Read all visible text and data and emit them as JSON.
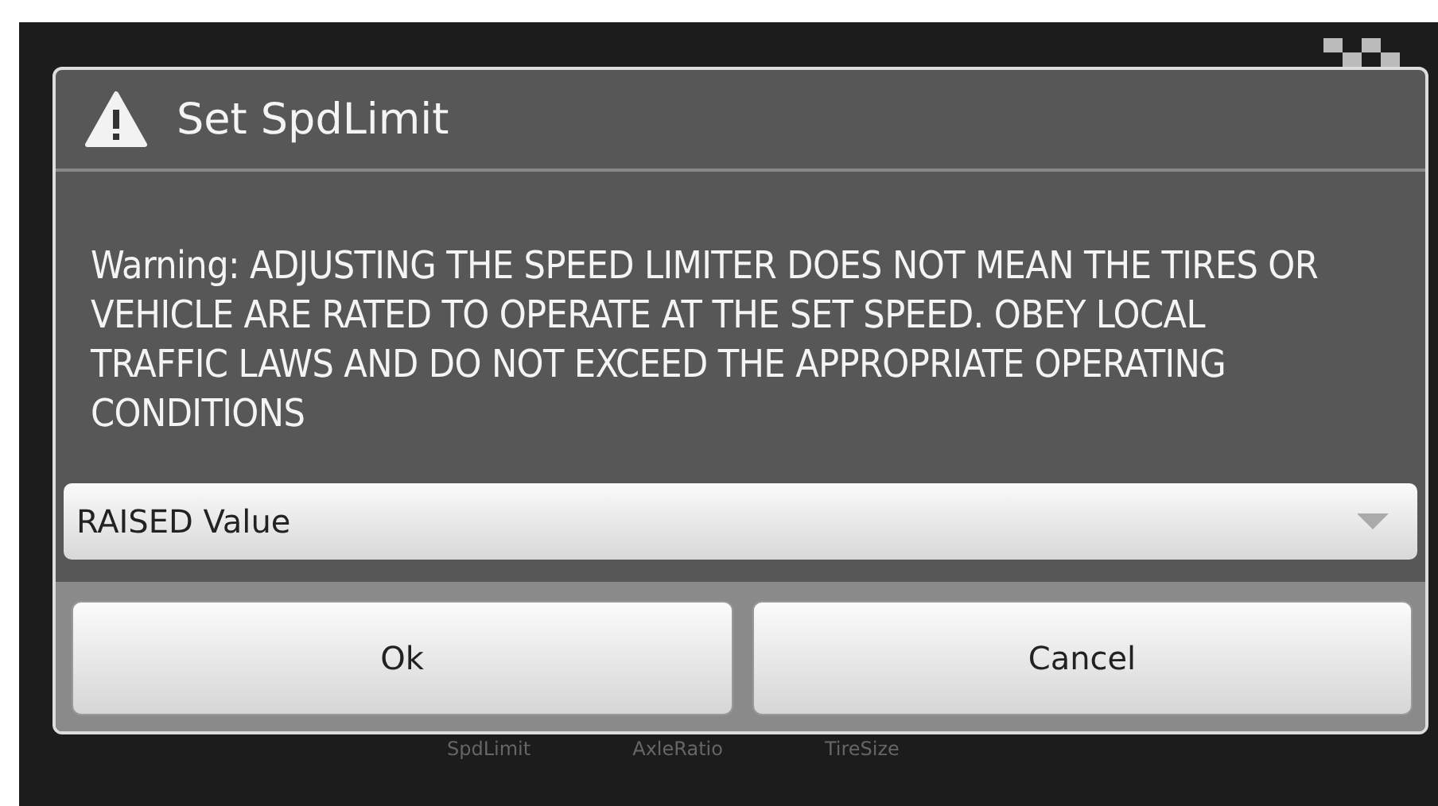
{
  "dialog": {
    "title": "Set SpdLimit",
    "message": "Warning: ADJUSTING THE SPEED LIMITER DOES NOT MEAN THE TIRES OR VEHICLE ARE RATED TO OPERATE AT THE SET SPEED. OBEY LOCAL TRAFFIC LAWS AND DO NOT EXCEED THE APPROPRIATE OPERATING CONDITIONS",
    "dropdown": {
      "value": "RAISED Value"
    },
    "buttons": [
      "Ok",
      "Cancel"
    ]
  },
  "background_labels": [
    "SpdLimit",
    "AxleRatio",
    "TireSize"
  ]
}
